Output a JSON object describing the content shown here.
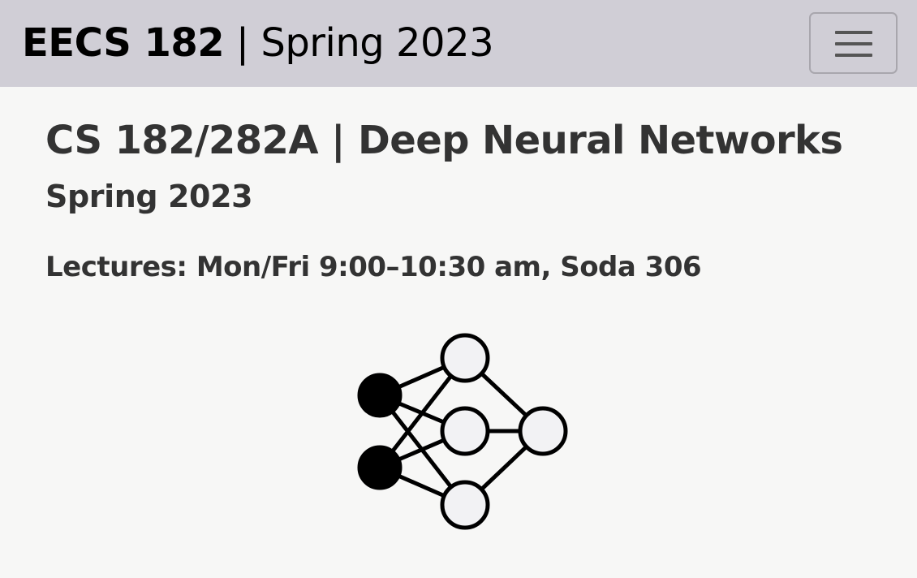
{
  "navbar": {
    "brand_course": "EECS 182",
    "brand_separator": " | ",
    "brand_term": "Spring 2023",
    "menu_icon": "hamburger-menu-icon"
  },
  "main": {
    "title": "CS 182/282A | Deep Neural Networks",
    "subtitle": "Spring 2023",
    "lectures": "Lectures: Mon/Fri 9:00–10:30 am, Soda 306"
  },
  "logo": {
    "icon": "neural-network-icon",
    "input_node_color": "#000000",
    "node_fill": "#f2f2f4",
    "stroke": "#000000"
  },
  "colors": {
    "navbar_bg": "#d0ced6",
    "page_bg": "#f7f7f6",
    "text": "#333333"
  }
}
